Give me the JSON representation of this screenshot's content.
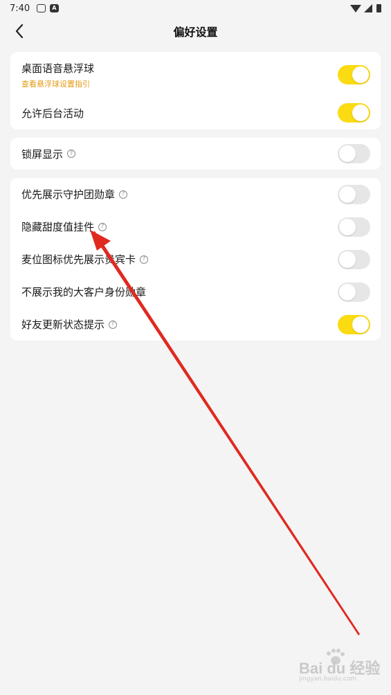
{
  "status_bar": {
    "time": "7:40"
  },
  "nav": {
    "title": "偏好设置",
    "back_icon": "chevron-left-icon"
  },
  "groups": [
    {
      "items": [
        {
          "label": "桌面语音悬浮球",
          "sub": "查看悬浮球设置指引",
          "on": true,
          "help": false
        },
        {
          "label": "允许后台活动",
          "on": true,
          "help": false
        }
      ]
    },
    {
      "items": [
        {
          "label": "锁屏显示",
          "on": false,
          "help": true
        }
      ]
    },
    {
      "items": [
        {
          "label": "优先展示守护团勋章",
          "on": false,
          "help": true
        },
        {
          "label": "隐藏甜度值挂件",
          "on": false,
          "help": true
        },
        {
          "label": "麦位图标优先展示贵宾卡",
          "on": false,
          "help": true
        },
        {
          "label": "不展示我的大客户身份勋章",
          "on": false,
          "help": false
        },
        {
          "label": "好友更新状态提示",
          "on": true,
          "help": true
        }
      ]
    }
  ],
  "help_glyph": "?",
  "watermark": {
    "main": "Bai du 经验",
    "sub": "jingyan.baidu.com"
  },
  "colors": {
    "toggle_on": "#fbdb11",
    "toggle_off": "#e6e6e6",
    "link": "#e39a12",
    "annotation_arrow": "#e02a20"
  }
}
